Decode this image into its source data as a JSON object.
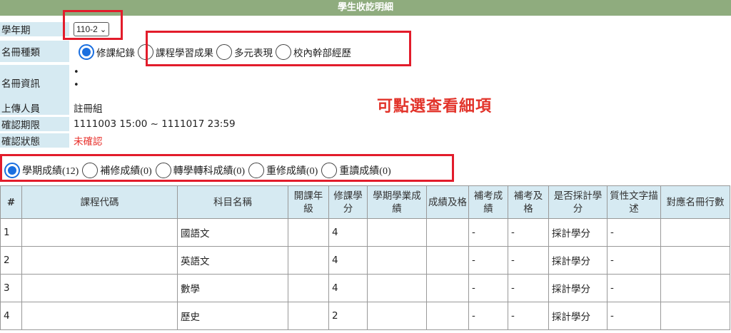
{
  "page_title": "學生收訖明細",
  "term": {
    "label": "學年期",
    "selected": "110-2",
    "arrow": "⌄"
  },
  "roster_type": {
    "label": "名冊種類",
    "options": [
      "修課紀錄",
      "課程學習成果",
      "多元表現",
      "校內幹部經歷"
    ],
    "selected_index": 0
  },
  "roster_info": {
    "label": "名冊資訊",
    "bullets": [
      "•",
      "•"
    ]
  },
  "uploader": {
    "label": "上傳人員",
    "value": "註冊組"
  },
  "confirm_period": {
    "label": "確認期限",
    "value": "1111003 15:00 ~ 1111017 23:59"
  },
  "confirm_status": {
    "label": "確認狀態",
    "value": "未確認",
    "color": "#e8312c"
  },
  "annotation": "可點選查看細項",
  "grade_type": {
    "options": [
      "學期成績(12)",
      "補修成績(0)",
      "轉學轉科成績(0)",
      "重修成績(0)",
      "重讀成績(0)"
    ],
    "selected_index": 0
  },
  "table": {
    "headers": [
      "#",
      "課程代碼",
      "科目名稱",
      "開課年級",
      "修課學分",
      "學期學業成績",
      "成績及格",
      "補考成績",
      "補考及格",
      "是否採計學分",
      "質性文字描述",
      "對應名冊行數"
    ],
    "rows": [
      [
        "1",
        "",
        "國語文",
        "",
        "4",
        "",
        "",
        "-",
        "-",
        "採計學分",
        "-",
        ""
      ],
      [
        "2",
        "",
        "英語文",
        "",
        "4",
        "",
        "",
        "-",
        "-",
        "採計學分",
        "-",
        ""
      ],
      [
        "3",
        "",
        "數學",
        "",
        "4",
        "",
        "",
        "-",
        "-",
        "採計學分",
        "-",
        ""
      ],
      [
        "4",
        "",
        "歷史",
        "",
        "2",
        "",
        "",
        "-",
        "-",
        "採計學分",
        "-",
        ""
      ]
    ]
  },
  "colors": {
    "header_bar": "#8fac7e",
    "label_bg": "#d6eaf2",
    "highlight_box": "#e21c2b",
    "radio_selected": "#1a6fe0"
  }
}
